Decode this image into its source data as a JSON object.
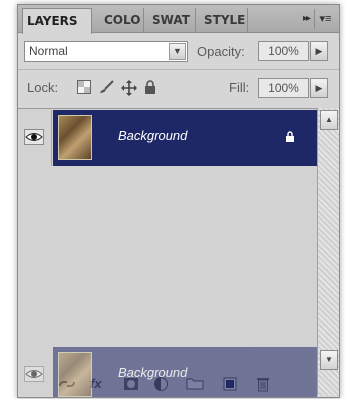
{
  "tabs": [
    {
      "label": "LAYERS",
      "active": true
    },
    {
      "label": "COLO",
      "active": false
    },
    {
      "label": "SWAT",
      "active": false
    },
    {
      "label": "STYLE",
      "active": false
    }
  ],
  "tab_overflow_glyph": "▸▸",
  "tab_menu_glyph": "▾≡",
  "blend_mode": {
    "value": "Normal"
  },
  "opacity": {
    "label": "Opacity:",
    "value": "100%"
  },
  "lock": {
    "label": "Lock:"
  },
  "fill": {
    "label": "Fill:",
    "value": "100%"
  },
  "layers": [
    {
      "name": "Background",
      "visible": true,
      "locked": true,
      "selected": true
    }
  ],
  "drag_ghost": {
    "name": "Background"
  },
  "colors": {
    "selection": "#1f2866",
    "panel": "#d6d6d6"
  }
}
